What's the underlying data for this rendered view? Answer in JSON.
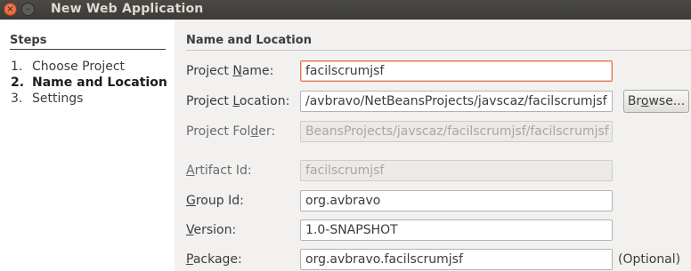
{
  "window": {
    "title": "New Web Application",
    "close_glyph": "×",
    "minimize_glyph": "–"
  },
  "steps": {
    "title": "Steps",
    "items": [
      {
        "num": "1.",
        "label": "Choose Project"
      },
      {
        "num": "2.",
        "label": "Name and Location"
      },
      {
        "num": "3.",
        "label": "Settings"
      }
    ]
  },
  "section": {
    "title": "Name and Location"
  },
  "form": {
    "project_name": {
      "label_pre": "Project ",
      "label_mnemonic": "N",
      "label_post": "ame:",
      "value": "facilscrumjsf"
    },
    "project_location": {
      "label_pre": "Project ",
      "label_mnemonic": "L",
      "label_post": "ocation:",
      "value": "/avbravo/NetBeansProjects/javscaz/facilscrumjsf"
    },
    "project_folder": {
      "label_pre": "Project Fol",
      "label_mnemonic": "d",
      "label_post": "er:",
      "value": "BeansProjects/javscaz/facilscrumjsf/facilscrumjsf"
    },
    "artifact_id": {
      "label_pre": "",
      "label_mnemonic": "A",
      "label_post": "rtifact Id:",
      "value": "facilscrumjsf"
    },
    "group_id": {
      "label_pre": "",
      "label_mnemonic": "G",
      "label_post": "roup Id:",
      "value": "org.avbravo"
    },
    "version": {
      "label_pre": "",
      "label_mnemonic": "V",
      "label_post": "ersion:",
      "value": "1.0-SNAPSHOT"
    },
    "package": {
      "label_pre": "",
      "label_mnemonic": "P",
      "label_post": "ackage:",
      "value": "org.avbravo.facilscrumjsf",
      "hint": "(Optional)"
    }
  },
  "buttons": {
    "browse": {
      "pre": "Br",
      "mnemonic": "o",
      "post": "wse..."
    }
  },
  "colors": {
    "titlebar": "#3c3b37",
    "close_button": "#e05a2b",
    "focus_border": "#e8704a",
    "window_bg": "#f2f1f0"
  }
}
